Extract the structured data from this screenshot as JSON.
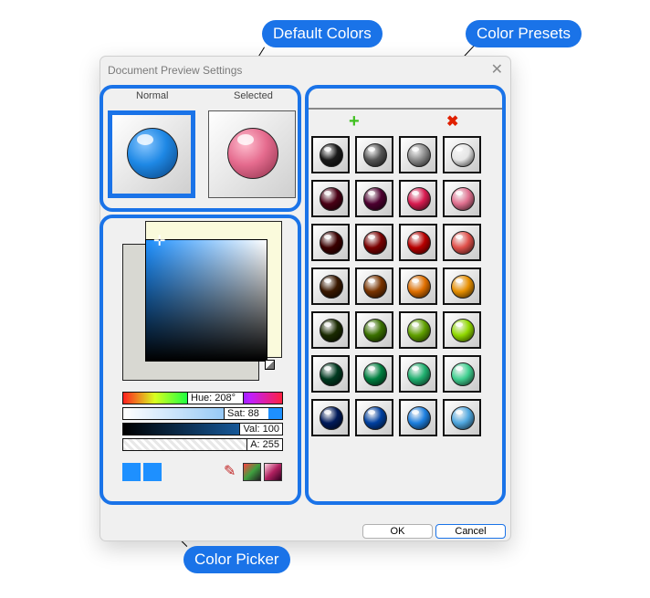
{
  "dialog": {
    "title": "Document Preview Settings",
    "close_icon": "close-icon",
    "ok_label": "OK",
    "cancel_label": "Cancel"
  },
  "callouts": {
    "default_colors": "Default Colors",
    "color_presets": "Color Presets",
    "color_picker": "Color Picker"
  },
  "default_colors": {
    "normal_label": "Normal",
    "selected_label": "Selected",
    "normal_color": "#1e88e5",
    "selected_color": "#e56b8e"
  },
  "color_picker": {
    "hue_label": "Hue: 208°",
    "sat_label": "Sat: 88",
    "val_label": "Val: 100",
    "alpha_label": "A: 255",
    "current_color": "#1e90ff",
    "tools": [
      "eyedropper-icon",
      "rgb-cube-icon",
      "hsv-cube-icon"
    ]
  },
  "presets": {
    "add_icon": "plus-icon",
    "delete_icon": "x-icon",
    "colors": [
      [
        "#1a1a1a",
        "#555555",
        "#8c8c8c",
        "#e6e6e6"
      ],
      [
        "#4a0015",
        "#4d0030",
        "#d81b50",
        "#e0708f"
      ],
      [
        "#3a0000",
        "#7a0000",
        "#b80000",
        "#e0504a"
      ],
      [
        "#3a1800",
        "#7a3400",
        "#e07000",
        "#e89000"
      ],
      [
        "#1a2a00",
        "#3a7000",
        "#60a000",
        "#90d800"
      ],
      [
        "#003a20",
        "#008040",
        "#20b070",
        "#40d090"
      ],
      [
        "#001a5a",
        "#0040a0",
        "#1e80e0",
        "#50a8e0"
      ]
    ]
  }
}
